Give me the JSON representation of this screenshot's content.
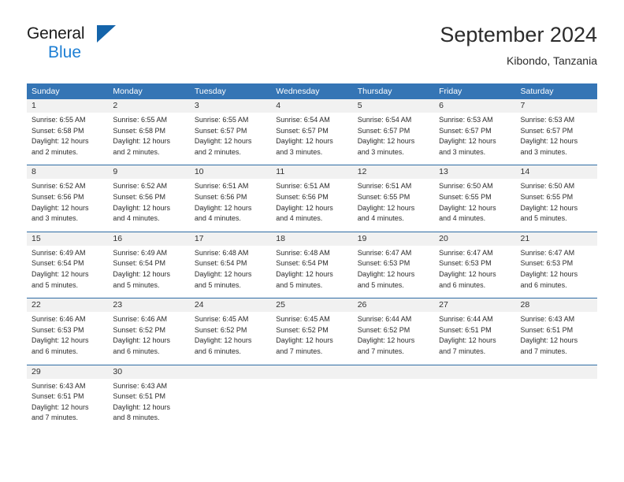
{
  "brand": {
    "name_top": "General",
    "name_bottom": "Blue",
    "accent_color": "#1e7fd4",
    "triangle_color": "#1464aa"
  },
  "header": {
    "title": "September 2024",
    "subtitle": "Kibondo, Tanzania"
  },
  "calendar": {
    "header_bg": "#3575b5",
    "header_text_color": "#ffffff",
    "row_divider_color": "#2e6ca4",
    "daynum_bg": "#f1f1f1",
    "weekdays": [
      "Sunday",
      "Monday",
      "Tuesday",
      "Wednesday",
      "Thursday",
      "Friday",
      "Saturday"
    ],
    "weeks": [
      [
        {
          "day": "1",
          "sunrise": "Sunrise: 6:55 AM",
          "sunset": "Sunset: 6:58 PM",
          "daylight1": "Daylight: 12 hours",
          "daylight2": "and 2 minutes."
        },
        {
          "day": "2",
          "sunrise": "Sunrise: 6:55 AM",
          "sunset": "Sunset: 6:58 PM",
          "daylight1": "Daylight: 12 hours",
          "daylight2": "and 2 minutes."
        },
        {
          "day": "3",
          "sunrise": "Sunrise: 6:55 AM",
          "sunset": "Sunset: 6:57 PM",
          "daylight1": "Daylight: 12 hours",
          "daylight2": "and 2 minutes."
        },
        {
          "day": "4",
          "sunrise": "Sunrise: 6:54 AM",
          "sunset": "Sunset: 6:57 PM",
          "daylight1": "Daylight: 12 hours",
          "daylight2": "and 3 minutes."
        },
        {
          "day": "5",
          "sunrise": "Sunrise: 6:54 AM",
          "sunset": "Sunset: 6:57 PM",
          "daylight1": "Daylight: 12 hours",
          "daylight2": "and 3 minutes."
        },
        {
          "day": "6",
          "sunrise": "Sunrise: 6:53 AM",
          "sunset": "Sunset: 6:57 PM",
          "daylight1": "Daylight: 12 hours",
          "daylight2": "and 3 minutes."
        },
        {
          "day": "7",
          "sunrise": "Sunrise: 6:53 AM",
          "sunset": "Sunset: 6:57 PM",
          "daylight1": "Daylight: 12 hours",
          "daylight2": "and 3 minutes."
        }
      ],
      [
        {
          "day": "8",
          "sunrise": "Sunrise: 6:52 AM",
          "sunset": "Sunset: 6:56 PM",
          "daylight1": "Daylight: 12 hours",
          "daylight2": "and 3 minutes."
        },
        {
          "day": "9",
          "sunrise": "Sunrise: 6:52 AM",
          "sunset": "Sunset: 6:56 PM",
          "daylight1": "Daylight: 12 hours",
          "daylight2": "and 4 minutes."
        },
        {
          "day": "10",
          "sunrise": "Sunrise: 6:51 AM",
          "sunset": "Sunset: 6:56 PM",
          "daylight1": "Daylight: 12 hours",
          "daylight2": "and 4 minutes."
        },
        {
          "day": "11",
          "sunrise": "Sunrise: 6:51 AM",
          "sunset": "Sunset: 6:56 PM",
          "daylight1": "Daylight: 12 hours",
          "daylight2": "and 4 minutes."
        },
        {
          "day": "12",
          "sunrise": "Sunrise: 6:51 AM",
          "sunset": "Sunset: 6:55 PM",
          "daylight1": "Daylight: 12 hours",
          "daylight2": "and 4 minutes."
        },
        {
          "day": "13",
          "sunrise": "Sunrise: 6:50 AM",
          "sunset": "Sunset: 6:55 PM",
          "daylight1": "Daylight: 12 hours",
          "daylight2": "and 4 minutes."
        },
        {
          "day": "14",
          "sunrise": "Sunrise: 6:50 AM",
          "sunset": "Sunset: 6:55 PM",
          "daylight1": "Daylight: 12 hours",
          "daylight2": "and 5 minutes."
        }
      ],
      [
        {
          "day": "15",
          "sunrise": "Sunrise: 6:49 AM",
          "sunset": "Sunset: 6:54 PM",
          "daylight1": "Daylight: 12 hours",
          "daylight2": "and 5 minutes."
        },
        {
          "day": "16",
          "sunrise": "Sunrise: 6:49 AM",
          "sunset": "Sunset: 6:54 PM",
          "daylight1": "Daylight: 12 hours",
          "daylight2": "and 5 minutes."
        },
        {
          "day": "17",
          "sunrise": "Sunrise: 6:48 AM",
          "sunset": "Sunset: 6:54 PM",
          "daylight1": "Daylight: 12 hours",
          "daylight2": "and 5 minutes."
        },
        {
          "day": "18",
          "sunrise": "Sunrise: 6:48 AM",
          "sunset": "Sunset: 6:54 PM",
          "daylight1": "Daylight: 12 hours",
          "daylight2": "and 5 minutes."
        },
        {
          "day": "19",
          "sunrise": "Sunrise: 6:47 AM",
          "sunset": "Sunset: 6:53 PM",
          "daylight1": "Daylight: 12 hours",
          "daylight2": "and 5 minutes."
        },
        {
          "day": "20",
          "sunrise": "Sunrise: 6:47 AM",
          "sunset": "Sunset: 6:53 PM",
          "daylight1": "Daylight: 12 hours",
          "daylight2": "and 6 minutes."
        },
        {
          "day": "21",
          "sunrise": "Sunrise: 6:47 AM",
          "sunset": "Sunset: 6:53 PM",
          "daylight1": "Daylight: 12 hours",
          "daylight2": "and 6 minutes."
        }
      ],
      [
        {
          "day": "22",
          "sunrise": "Sunrise: 6:46 AM",
          "sunset": "Sunset: 6:53 PM",
          "daylight1": "Daylight: 12 hours",
          "daylight2": "and 6 minutes."
        },
        {
          "day": "23",
          "sunrise": "Sunrise: 6:46 AM",
          "sunset": "Sunset: 6:52 PM",
          "daylight1": "Daylight: 12 hours",
          "daylight2": "and 6 minutes."
        },
        {
          "day": "24",
          "sunrise": "Sunrise: 6:45 AM",
          "sunset": "Sunset: 6:52 PM",
          "daylight1": "Daylight: 12 hours",
          "daylight2": "and 6 minutes."
        },
        {
          "day": "25",
          "sunrise": "Sunrise: 6:45 AM",
          "sunset": "Sunset: 6:52 PM",
          "daylight1": "Daylight: 12 hours",
          "daylight2": "and 7 minutes."
        },
        {
          "day": "26",
          "sunrise": "Sunrise: 6:44 AM",
          "sunset": "Sunset: 6:52 PM",
          "daylight1": "Daylight: 12 hours",
          "daylight2": "and 7 minutes."
        },
        {
          "day": "27",
          "sunrise": "Sunrise: 6:44 AM",
          "sunset": "Sunset: 6:51 PM",
          "daylight1": "Daylight: 12 hours",
          "daylight2": "and 7 minutes."
        },
        {
          "day": "28",
          "sunrise": "Sunrise: 6:43 AM",
          "sunset": "Sunset: 6:51 PM",
          "daylight1": "Daylight: 12 hours",
          "daylight2": "and 7 minutes."
        }
      ],
      [
        {
          "day": "29",
          "sunrise": "Sunrise: 6:43 AM",
          "sunset": "Sunset: 6:51 PM",
          "daylight1": "Daylight: 12 hours",
          "daylight2": "and 7 minutes."
        },
        {
          "day": "30",
          "sunrise": "Sunrise: 6:43 AM",
          "sunset": "Sunset: 6:51 PM",
          "daylight1": "Daylight: 12 hours",
          "daylight2": "and 8 minutes."
        },
        {
          "day": "",
          "sunrise": "",
          "sunset": "",
          "daylight1": "",
          "daylight2": ""
        },
        {
          "day": "",
          "sunrise": "",
          "sunset": "",
          "daylight1": "",
          "daylight2": ""
        },
        {
          "day": "",
          "sunrise": "",
          "sunset": "",
          "daylight1": "",
          "daylight2": ""
        },
        {
          "day": "",
          "sunrise": "",
          "sunset": "",
          "daylight1": "",
          "daylight2": ""
        },
        {
          "day": "",
          "sunrise": "",
          "sunset": "",
          "daylight1": "",
          "daylight2": ""
        }
      ]
    ]
  }
}
